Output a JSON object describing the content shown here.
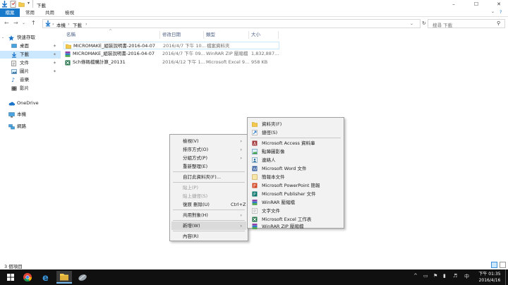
{
  "window": {
    "title": "下載",
    "controls": [
      "–",
      "☐",
      "✕"
    ]
  },
  "ribbon": {
    "tabs": [
      "檔案",
      "常用",
      "共用",
      "檢視"
    ],
    "help": "?"
  },
  "addressbar": {
    "path": [
      "本機",
      "下載"
    ],
    "search_placeholder": "搜尋 下載"
  },
  "sidebar": {
    "items": [
      {
        "label": "快速存取",
        "icon": "star-icon"
      },
      {
        "label": "桌面",
        "icon": "desktop-icon",
        "pinned": true
      },
      {
        "label": "下載",
        "icon": "download-icon",
        "pinned": true,
        "selected": true
      },
      {
        "label": "文件",
        "icon": "document-icon",
        "pinned": true
      },
      {
        "label": "圖片",
        "icon": "picture-icon",
        "pinned": true
      },
      {
        "label": "音樂",
        "icon": "music-icon"
      },
      {
        "label": "影片",
        "icon": "video-icon"
      },
      {
        "label": "OneDrive",
        "icon": "cloud-icon"
      },
      {
        "label": "本機",
        "icon": "computer-icon"
      },
      {
        "label": "網路",
        "icon": "network-icon"
      }
    ]
  },
  "filelist": {
    "columns": [
      "名稱",
      "修改日期",
      "類型",
      "大小"
    ],
    "rows": [
      {
        "name": "MICROMAKE_組裝說明書-2016-04-07",
        "date": "2016/4/7 下午 10...",
        "type": "檔案資料夾",
        "size": "",
        "icon": "folder-icon"
      },
      {
        "name": "MICROMAKE_組裝說明書-2016-04-07",
        "date": "2016/4/7 下午 09...",
        "type": "WinRAR ZIP 壓縮檔",
        "size": "1,832,887...",
        "icon": "winrar-icon"
      },
      {
        "name": "Sch條碼檔購計算_20131",
        "date": "2016/4/12 下午 1...",
        "type": "Microsoft Excel 9...",
        "size": "958 KB",
        "icon": "excel-icon"
      }
    ]
  },
  "status": {
    "text": "3 個項目"
  },
  "context_menu": {
    "items": [
      {
        "label": "檢視(V)",
        "arrow": true
      },
      {
        "label": "排序方式(O)",
        "arrow": true
      },
      {
        "label": "分組方式(P)",
        "arrow": true
      },
      {
        "label": "重新整理(E)"
      },
      {
        "separator": true
      },
      {
        "label": "自訂此資料夾(F)..."
      },
      {
        "separator": true
      },
      {
        "label": "貼上(P)",
        "disabled": true
      },
      {
        "label": "貼上捷徑(S)",
        "disabled": true
      },
      {
        "label": "復原 刪除(U)",
        "shortcut": "Ctrl+Z"
      },
      {
        "separator": true
      },
      {
        "label": "共用對象(H)",
        "arrow": true
      },
      {
        "separator": true
      },
      {
        "label": "新增(W)",
        "arrow": true,
        "highlighted": true
      },
      {
        "separator": true
      },
      {
        "label": "內容(R)"
      }
    ]
  },
  "submenu_new": {
    "items": [
      {
        "label": "資料夾(F)",
        "icon": "folder-icon"
      },
      {
        "label": "捷徑(S)",
        "icon": "shortcut-icon"
      },
      {
        "separator": true
      },
      {
        "label": "Microsoft Access 資料庫",
        "icon": "access-icon"
      },
      {
        "label": "點陣圖影像",
        "icon": "bitmap-icon"
      },
      {
        "label": "連絡人",
        "icon": "contact-icon"
      },
      {
        "label": "Microsoft Word 文件",
        "icon": "word-icon"
      },
      {
        "label": "簡報本文件",
        "icon": "journal-icon"
      },
      {
        "label": "Microsoft PowerPoint 簡報",
        "icon": "powerpoint-icon"
      },
      {
        "label": "Microsoft Publisher 文件",
        "icon": "publisher-icon"
      },
      {
        "label": "WinRAR 壓縮檔",
        "icon": "winrar-icon"
      },
      {
        "label": "文字文件",
        "icon": "text-icon"
      },
      {
        "label": "Microsoft Excel 工作表",
        "icon": "excel-icon"
      },
      {
        "label": "WinRAR ZIP 壓縮檔",
        "icon": "winrar-zip-icon"
      }
    ]
  },
  "taskbar": {
    "apps": [
      "windows-icon",
      "chrome-icon",
      "edge-icon",
      "file-explorer-icon",
      "app-icon"
    ],
    "tray_chevron": "^",
    "ime": "中",
    "time": "下午 01:35",
    "date": "2016/4/16"
  },
  "colors": {
    "accent": "#1979ca",
    "selection": "#cce8ff",
    "taskbar": "#101010"
  }
}
